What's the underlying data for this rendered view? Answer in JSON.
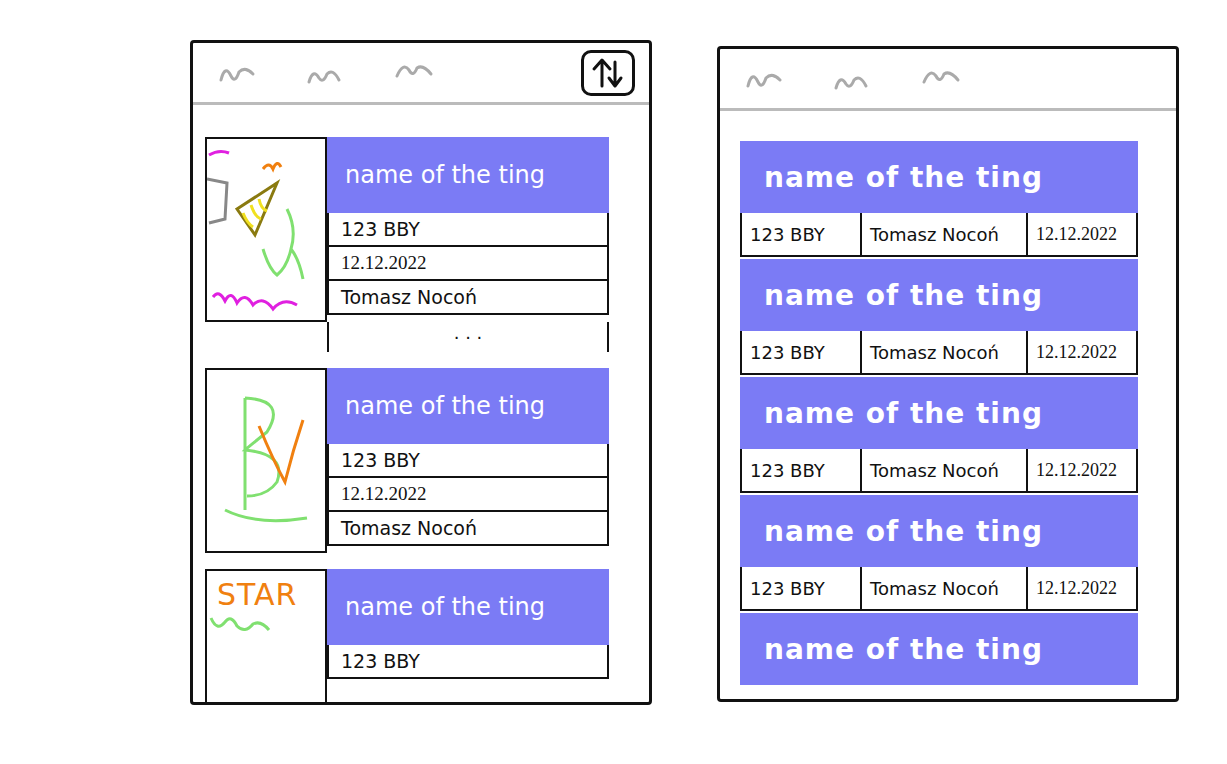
{
  "screens": [
    {
      "kind": "detailed",
      "has_sort_button": true,
      "items": [
        {
          "title": "name of the ting",
          "price": "123 BBY",
          "date": "12.12.2022",
          "author": "Tomasz Nocoń",
          "picture": {
            "kind": "hat"
          },
          "more": "· · ·"
        },
        {
          "title": "name of the ting",
          "price": "123 BBY",
          "date": "12.12.2022",
          "author": "Tomasz Nocoń",
          "picture": {
            "kind": "scribble"
          }
        },
        {
          "title": "name of the ting",
          "price": "123 BBY",
          "picture": {
            "kind": "label",
            "text": "STAR"
          }
        }
      ]
    },
    {
      "kind": "compact",
      "has_sort_button": false,
      "items": [
        {
          "title": "name of the ting",
          "price": "123 BBY",
          "author": "Tomasz Nocoń",
          "date": "12.12.2022"
        },
        {
          "title": "name of the ting",
          "price": "123 BBY",
          "author": "Tomasz Nocoń",
          "date": "12.12.2022"
        },
        {
          "title": "name of the ting",
          "price": "123 BBY",
          "author": "Tomasz Nocoń",
          "date": "12.12.2022"
        },
        {
          "title": "name of the ting",
          "price": "123 BBY",
          "author": "Tomasz Nocoń",
          "date": "12.12.2022"
        },
        {
          "title": "name of the ting"
        }
      ]
    }
  ]
}
